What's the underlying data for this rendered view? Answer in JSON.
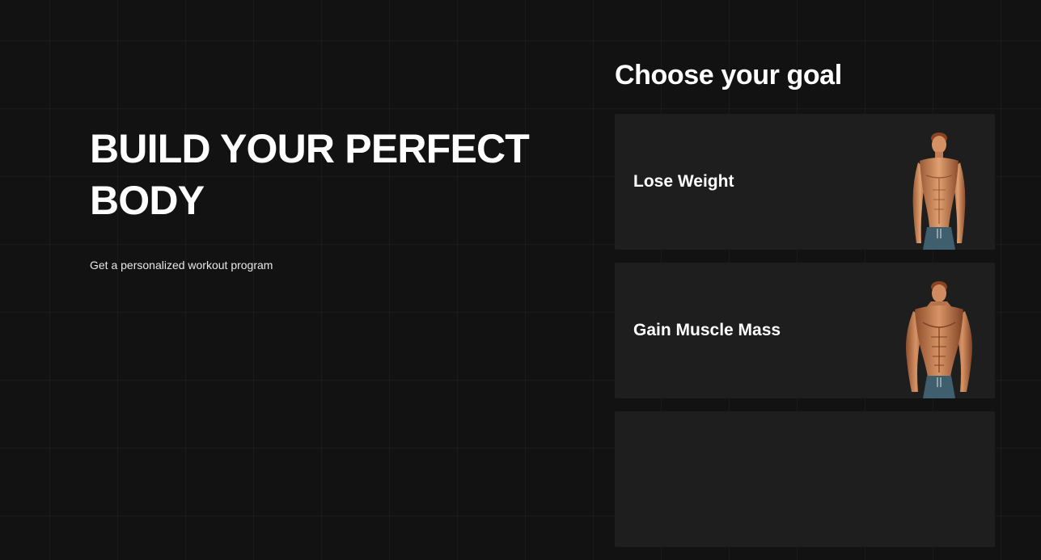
{
  "hero": {
    "title_line1": "BUILD YOUR PERFECT",
    "title_line2": "BODY",
    "subtitle": "Get a personalized workout program"
  },
  "goals": {
    "heading": "Choose your goal",
    "items": [
      {
        "label": "Lose Weight",
        "image": "lean-man-figure"
      },
      {
        "label": "Gain Muscle Mass",
        "image": "muscular-man-figure"
      }
    ]
  },
  "colors": {
    "background": "#121212",
    "card": "#1e1e1e",
    "text": "#ffffff",
    "shorts": "#3f5f6e"
  }
}
